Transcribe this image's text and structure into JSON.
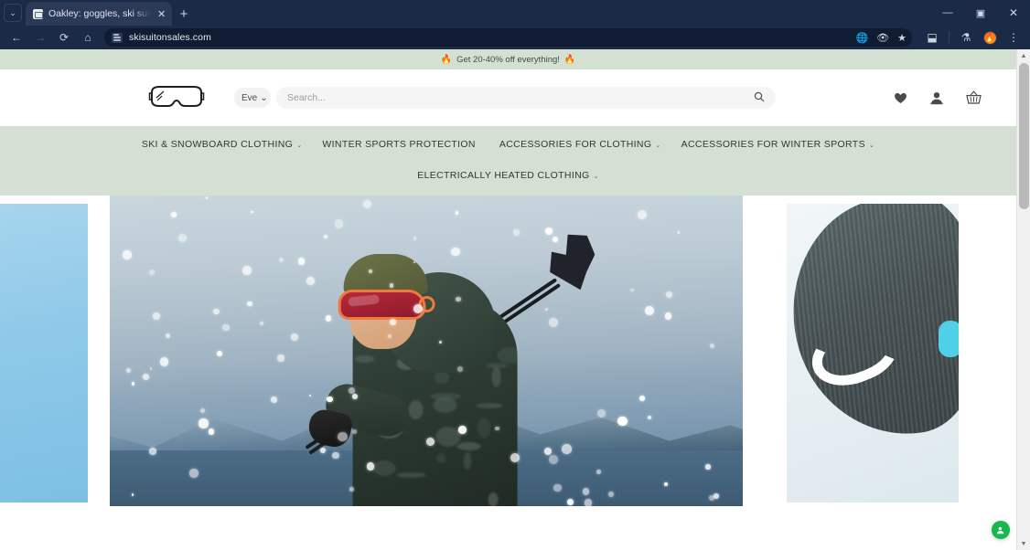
{
  "browser": {
    "tab": {
      "title": "Oakley: goggles, ski suits, ski p",
      "favicon_icon": "site-favicon-icon",
      "close_icon": "✕"
    },
    "new_tab_label": "+",
    "tab_list_chevron": "⌄",
    "window_controls": {
      "minimize": "—",
      "maximize": "▣",
      "close": "✕"
    },
    "nav": {
      "back_icon": "←",
      "forward_icon": "→",
      "reload_icon": "⟳",
      "home_icon": "⌂"
    },
    "omnibox": {
      "url": "skisuitonsales.com",
      "site_info_icon": "site-settings-icon",
      "translate_icon": "translate-icon",
      "tracking_icon": "eye-off-icon",
      "bookmark_icon": "★"
    },
    "toolbar_right": {
      "split_screen_icon": "⬓",
      "lab_icon": "⚗",
      "profile_icon": "profile-avatar-flame",
      "menu_icon": "⋮"
    }
  },
  "site": {
    "promo": {
      "flame_left": "🔥",
      "text": "Get 20-40% off everything!",
      "flame_right": "🔥"
    },
    "header": {
      "logo_name": "ski-goggles-logo",
      "category_select": {
        "value": "Eve",
        "chevron": "⌄"
      },
      "search": {
        "placeholder": "Search...",
        "value": "",
        "icon": "search-icon"
      },
      "icons": [
        {
          "name": "wishlist-icon",
          "glyph": "♥"
        },
        {
          "name": "account-icon",
          "glyph": "👤"
        },
        {
          "name": "cart-icon",
          "glyph": "🧺"
        }
      ]
    },
    "nav": {
      "row1": [
        {
          "label": "SKI & SNOWBOARD CLOTHING",
          "chevron": "⌄"
        },
        {
          "label": "WINTER SPORTS PROTECTION",
          "chevron": ""
        },
        {
          "label": "ACCESSORIES FOR CLOTHING",
          "chevron": "⌄"
        },
        {
          "label": "ACCESSORIES FOR WINTER SPORTS",
          "chevron": "⌄"
        }
      ],
      "row2": [
        {
          "label": "ELECTRICALLY HEATED CLOTHING",
          "chevron": "⌄"
        }
      ]
    },
    "carousel": {
      "slides": [
        {
          "name": "slide-blue-sky-hair",
          "alt": "Blue sky with windblown hair"
        },
        {
          "name": "slide-skier-hero",
          "alt": "Skier in camo jacket with orange goggles carrying skis in snowfall"
        },
        {
          "name": "slide-knit-beanie",
          "alt": "Grey knit beanie with white logo on snow"
        }
      ]
    },
    "chat_widget": {
      "name": "support-chat-button",
      "glyph": "💬"
    },
    "colors": {
      "promo_bg": "#d4e0d2",
      "nav_bg": "#d4e0d2",
      "nav_text": "#2f3a2f",
      "chrome_bg": "#1b2a47",
      "chat_green": "#16b84e",
      "goggle_orange": "#f07a3e"
    }
  },
  "scrollbar": {
    "up_arrow": "▲",
    "down_arrow": "▼"
  }
}
